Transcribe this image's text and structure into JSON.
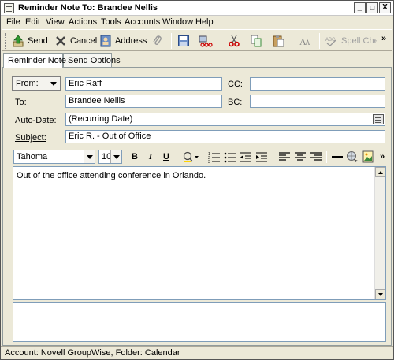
{
  "window": {
    "title": "Reminder Note To: Brandee Nellis"
  },
  "titlebar_buttons": {
    "minimize": "_",
    "maximize": "□",
    "close": "X"
  },
  "menu": [
    "File",
    "Edit",
    "View",
    "Actions",
    "Tools",
    "Accounts",
    "Window",
    "Help"
  ],
  "toolbar": {
    "send": "Send",
    "cancel": "Cancel",
    "address": "Address",
    "spell_check": "Spell Check",
    "overflow": "»"
  },
  "tabs": [
    "Reminder Note",
    "Send Options"
  ],
  "form": {
    "from_label": "From:",
    "from_value": "Eric Raff",
    "to_label": "To:",
    "to_value": "Brandee Nellis",
    "cc_label": "CC:",
    "cc_value": "",
    "bc_label": "BC:",
    "bc_value": "",
    "auto_date_label": "Auto-Date:",
    "auto_date_value": "(Recurring Date)",
    "subject_label": "Subject:",
    "subject_value": "Eric R. - Out of Office"
  },
  "format": {
    "font": "Tahoma",
    "size": "10",
    "bold": "B",
    "italic": "I",
    "underline": "U",
    "overflow": "»"
  },
  "body": {
    "text": "Out of the office attending conference in Orlando."
  },
  "status": {
    "text": "Account: Novell GroupWise,  Folder: Calendar"
  },
  "colors": {
    "window_bg": "#ece9d8",
    "input_border": "#7f9db9",
    "disabled_text": "#a0a0a0"
  }
}
